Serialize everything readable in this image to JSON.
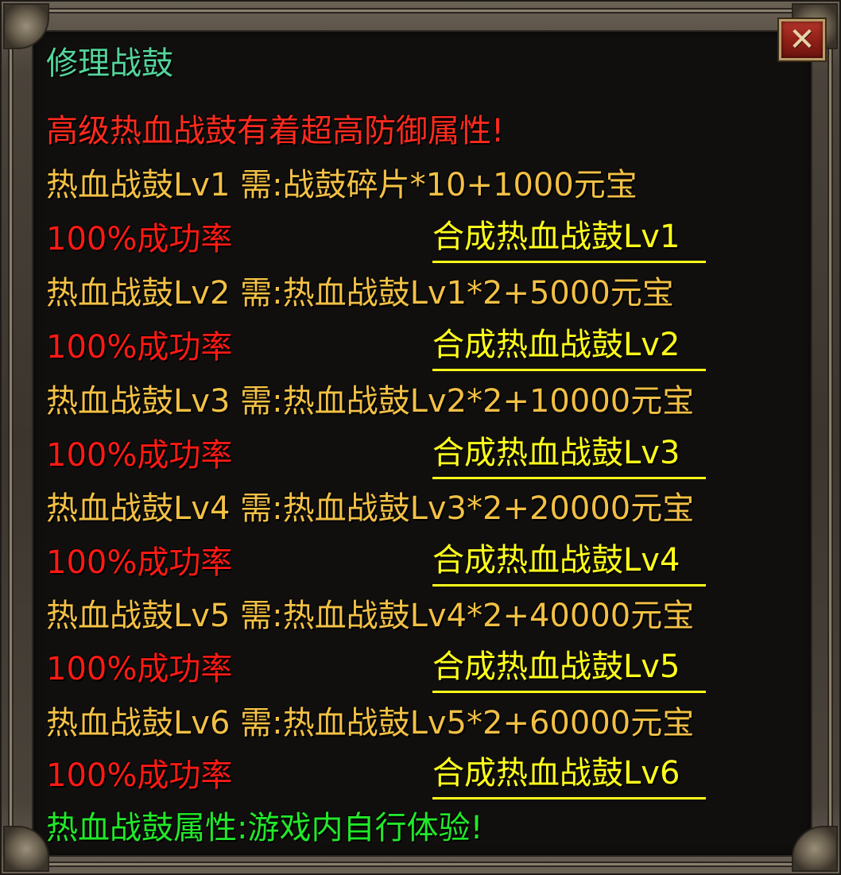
{
  "window": {
    "title": "修理战鼓",
    "close_label": "✕"
  },
  "subtitle": "高级热血战鼓有着超高防御属性!",
  "recipes": [
    {
      "requirement": "热血战鼓Lv1 需:战鼓碎片*10+1000元宝",
      "rate": "100%成功率",
      "action": "合成热血战鼓Lv1"
    },
    {
      "requirement": "热血战鼓Lv2 需:热血战鼓Lv1*2+5000元宝",
      "rate": "100%成功率",
      "action": "合成热血战鼓Lv2"
    },
    {
      "requirement": "热血战鼓Lv3 需:热血战鼓Lv2*2+10000元宝",
      "rate": "100%成功率",
      "action": "合成热血战鼓Lv3"
    },
    {
      "requirement": "热血战鼓Lv4 需:热血战鼓Lv3*2+20000元宝",
      "rate": "100%成功率",
      "action": "合成热血战鼓Lv4"
    },
    {
      "requirement": "热血战鼓Lv5 需:热血战鼓Lv4*2+40000元宝",
      "rate": "100%成功率",
      "action": "合成热血战鼓Lv5"
    },
    {
      "requirement": "热血战鼓Lv6 需:热血战鼓Lv5*2+60000元宝",
      "rate": "100%成功率",
      "action": "合成热血战鼓Lv6"
    }
  ],
  "footer": "热血战鼓属性:游戏内自行体验!",
  "colors": {
    "title": "#55d39a",
    "subtitle": "#ff2a1e",
    "requirement": "#f2c045",
    "rate": "#ff1a14",
    "action": "#ffff1a",
    "footer": "#22e82a"
  }
}
